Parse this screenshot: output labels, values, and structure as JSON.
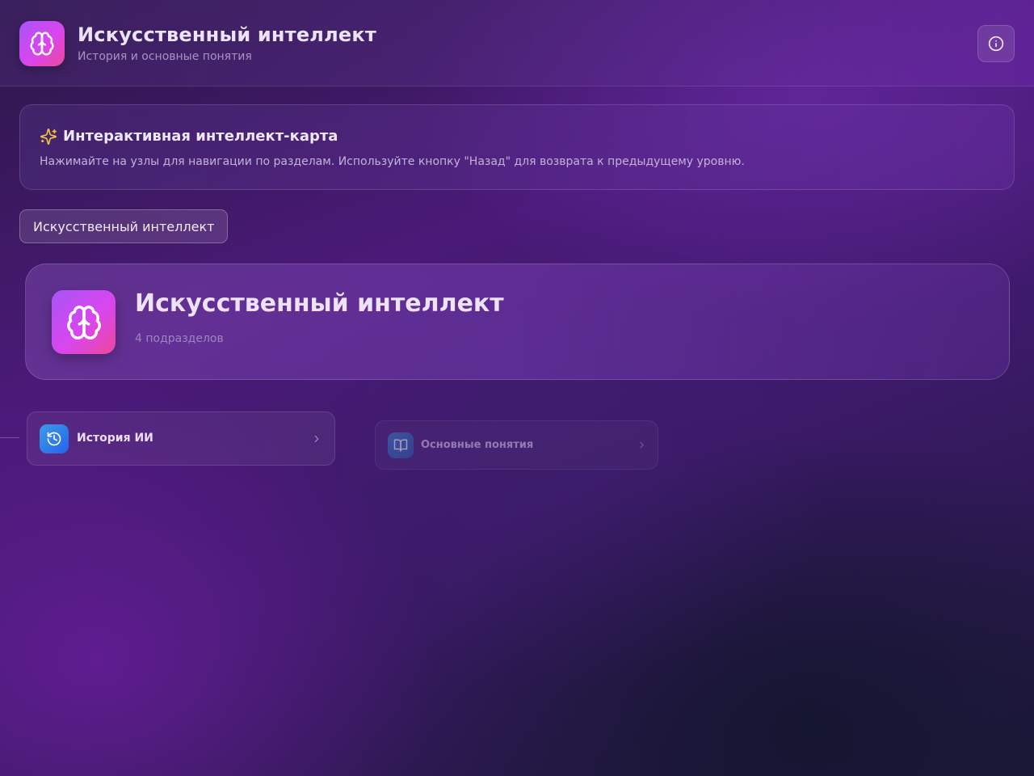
{
  "header": {
    "title": "Искусственный интеллект",
    "subtitle": "История и основные понятия",
    "logo_icon": "brain-icon",
    "info_icon": "info-icon"
  },
  "info_card": {
    "icon": "sparkles-icon",
    "title": "Интерактивная интеллект-карта",
    "text": "Нажимайте на узлы для навигации по разделам. Используйте кнопку \"Назад\" для возврата к предыдущему уровню."
  },
  "breadcrumb": {
    "items": [
      {
        "label": "Искусственный интеллект"
      }
    ]
  },
  "node": {
    "icon": "brain-icon",
    "title": "Искусственный интеллект",
    "subtitle": "4 подразделов"
  },
  "children": [
    {
      "label": "История ИИ",
      "icon": "history-icon",
      "color": "#3b9be8"
    },
    {
      "label": "Основные понятия",
      "icon": "book-icon",
      "color": "#3b82c8"
    }
  ],
  "colors": {
    "accent_gradient_start": "#a855f7",
    "accent_gradient_end": "#ec4899",
    "sparkle": "#f5c542"
  }
}
